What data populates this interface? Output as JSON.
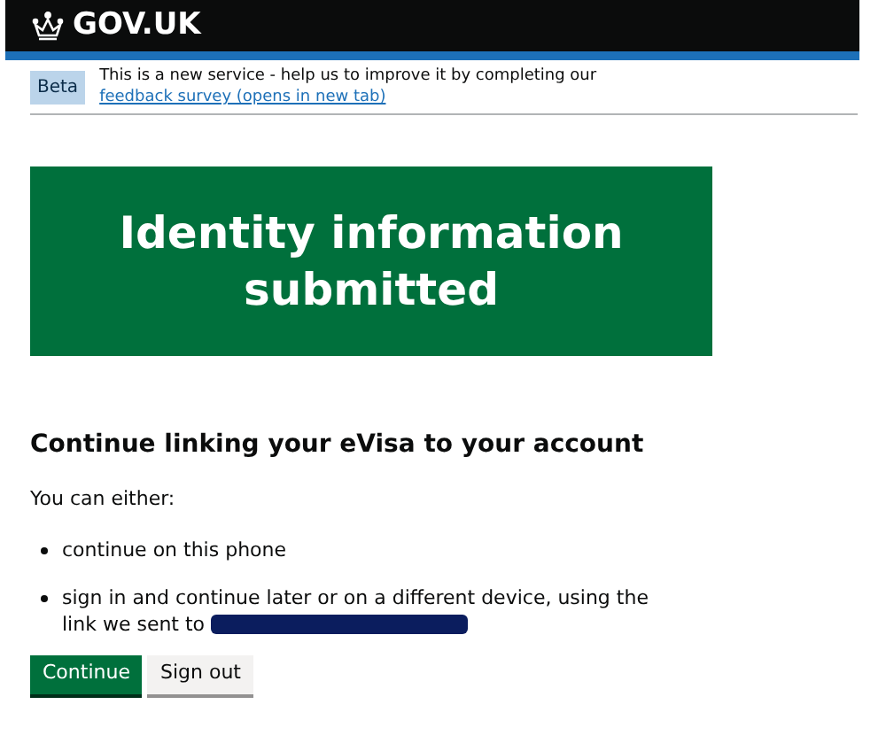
{
  "header": {
    "logo": "GOV.UK"
  },
  "phase_banner": {
    "tag": "Beta",
    "text": "This is a new service - help us to improve it by completing our",
    "link": "feedback survey (opens in new tab)"
  },
  "panel": {
    "title": "Identity information submitted"
  },
  "heading": "Continue linking your eVisa to your account",
  "intro": "You can either:",
  "options": [
    {
      "text": "continue on this phone",
      "redacted": false
    },
    {
      "text": "sign in and continue later or on a different device, using the link we sent to",
      "redacted": true
    }
  ],
  "buttons": [
    {
      "label": "Continue",
      "kind": "primary"
    },
    {
      "label": "Sign out",
      "kind": "secondary"
    }
  ]
}
